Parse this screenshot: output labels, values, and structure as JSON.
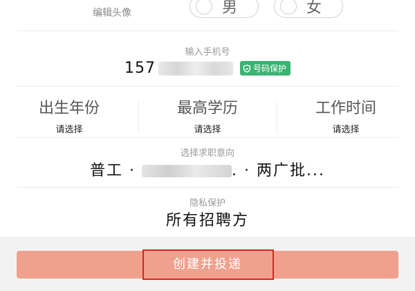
{
  "profile": {
    "edit_avatar_label": "编辑头像",
    "gender": {
      "male": "男",
      "female": "女"
    }
  },
  "phone": {
    "title": "输入手机号",
    "value_visible": "157",
    "protect_badge": "号码保护",
    "badge_color": "#3cb371"
  },
  "fields": [
    {
      "label": "出生年份",
      "value": "请选择"
    },
    {
      "label": "最高学历",
      "value": "请选择"
    },
    {
      "label": "工作时间",
      "value": "请选择"
    }
  ],
  "intent": {
    "title": "选择求职意向",
    "part1": "普工 · ",
    "part2": ". · 两广批..."
  },
  "privacy": {
    "title": "隐私保护",
    "value": "所有招聘方"
  },
  "submit": {
    "label": "创建并投递",
    "color": "#f0a18d"
  }
}
